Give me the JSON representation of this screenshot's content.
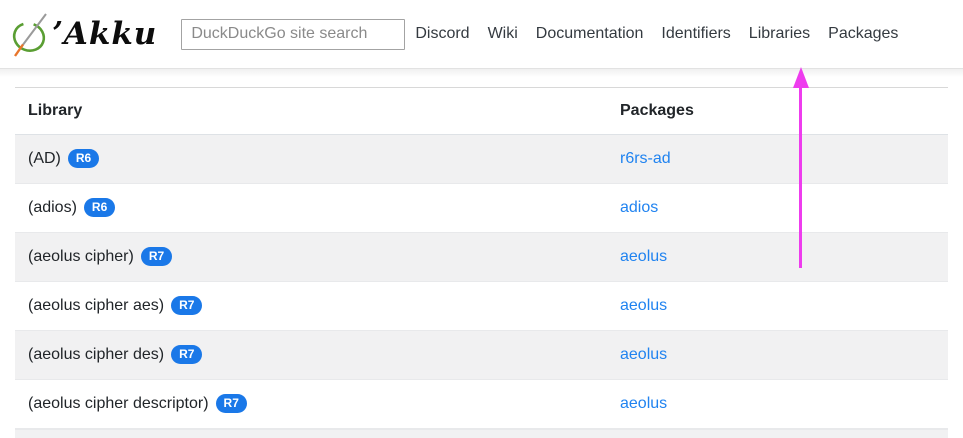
{
  "brand": {
    "name": "ʼAkku",
    "logo_icon": "akku-egg-and-needle-logo",
    "logo_colors": {
      "circle": "#5a9e33",
      "needle": "#9a9a9a",
      "needle_tip": "#e8762c"
    }
  },
  "header": {
    "search": {
      "placeholder": "DuckDuckGo site search",
      "value": ""
    },
    "nav": {
      "items": [
        {
          "label": "Discord"
        },
        {
          "label": "Wiki"
        },
        {
          "label": "Documentation"
        },
        {
          "label": "Identifiers"
        },
        {
          "label": "Libraries"
        },
        {
          "label": "Packages"
        }
      ]
    }
  },
  "table": {
    "columns": [
      "Library",
      "Packages"
    ],
    "rows": [
      {
        "library": "(AD)",
        "badge": "R6",
        "package": "r6rs-ad"
      },
      {
        "library": "(adios)",
        "badge": "R6",
        "package": "adios"
      },
      {
        "library": "(aeolus cipher)",
        "badge": "R7",
        "package": "aeolus"
      },
      {
        "library": "(aeolus cipher aes)",
        "badge": "R7",
        "package": "aeolus"
      },
      {
        "library": "(aeolus cipher des)",
        "badge": "R7",
        "package": "aeolus"
      },
      {
        "library": "(aeolus cipher descriptor)",
        "badge": "R7",
        "package": "aeolus"
      }
    ]
  },
  "annotation": {
    "type": "arrow-up",
    "points_at": "Libraries",
    "color": "#ee3cee"
  },
  "colors": {
    "link_blue": "#2083f0",
    "badge_blue": "#1a78e8",
    "row_stripe": "#f1f1f2"
  }
}
